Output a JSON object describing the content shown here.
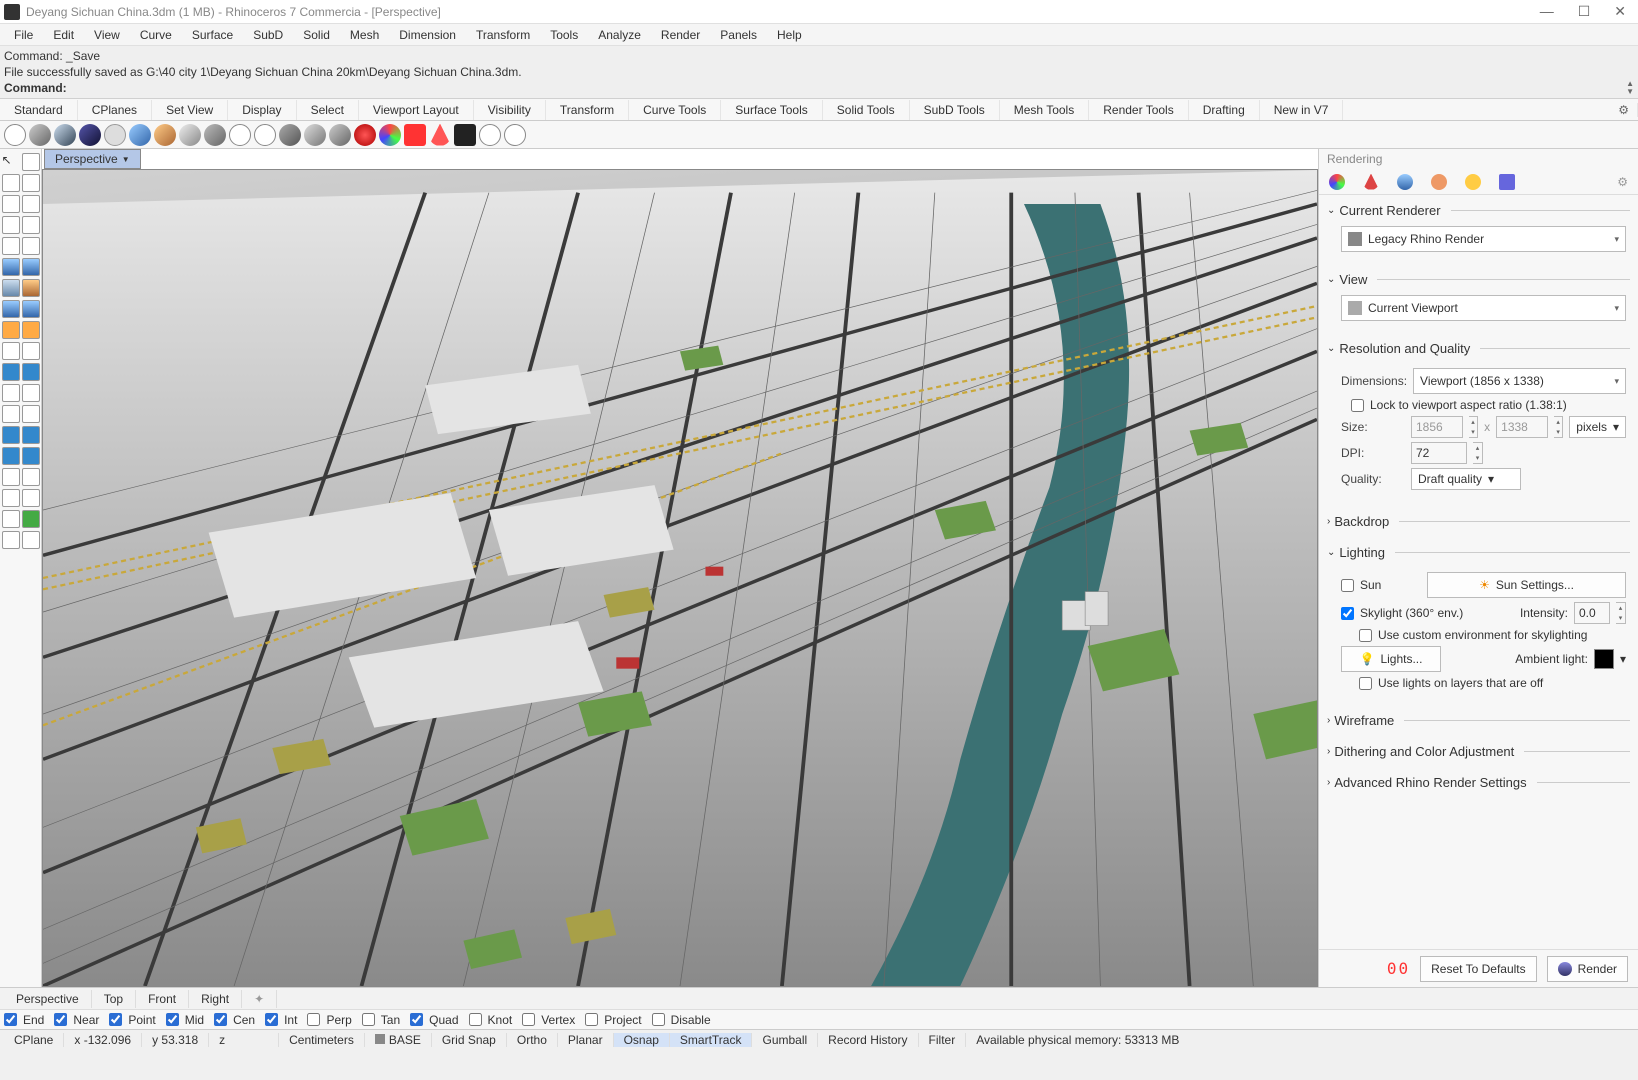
{
  "title": "Deyang Sichuan China.3dm (1 MB) - Rhinoceros 7 Commercia - [Perspective]",
  "menubar": [
    "File",
    "Edit",
    "View",
    "Curve",
    "Surface",
    "SubD",
    "Solid",
    "Mesh",
    "Dimension",
    "Transform",
    "Tools",
    "Analyze",
    "Render",
    "Panels",
    "Help"
  ],
  "cmd": {
    "line1": "Command: _Save",
    "line2": "File successfully saved as G:\\40 city 1\\Deyang Sichuan China 20km\\Deyang Sichuan China.3dm.",
    "prompt": "Command:"
  },
  "tabstrip": [
    "Standard",
    "CPlanes",
    "Set View",
    "Display",
    "Select",
    "Viewport Layout",
    "Visibility",
    "Transform",
    "Curve Tools",
    "Surface Tools",
    "Solid Tools",
    "SubD Tools",
    "Mesh Tools",
    "Render Tools",
    "Drafting",
    "New in V7"
  ],
  "viewport_tab": "Perspective",
  "panel": {
    "title": "Rendering",
    "sections": {
      "renderer": {
        "title": "Current Renderer",
        "value": "Legacy Rhino Render"
      },
      "view": {
        "title": "View",
        "value": "Current Viewport"
      },
      "resq": {
        "title": "Resolution and Quality",
        "dimensions_label": "Dimensions:",
        "dimensions_value": "Viewport (1856 x 1338)",
        "lock_label": "Lock to viewport aspect ratio (1.38:1)",
        "size_label": "Size:",
        "width": "1856",
        "height": "1338",
        "units": "pixels",
        "dpi_label": "DPI:",
        "dpi": "72",
        "quality_label": "Quality:",
        "quality_value": "Draft quality"
      },
      "backdrop": {
        "title": "Backdrop"
      },
      "lighting": {
        "title": "Lighting",
        "sun_label": "Sun",
        "sun_settings": "Sun Settings...",
        "skylight_label": "Skylight (360° env.)",
        "intensity_label": "Intensity:",
        "intensity_value": "0.0",
        "custom_env_label": "Use custom environment for skylighting",
        "lights_btn": "Lights...",
        "ambient_label": "Ambient light:",
        "use_lights_layers": "Use lights on layers that are off"
      },
      "wireframe": {
        "title": "Wireframe"
      },
      "dithering": {
        "title": "Dithering and Color Adjustment"
      },
      "advanced": {
        "title": "Advanced Rhino Render Settings"
      }
    },
    "footer": {
      "reset": "Reset To Defaults",
      "render": "Render"
    }
  },
  "viewtabs": [
    "Perspective",
    "Top",
    "Front",
    "Right"
  ],
  "osnap": {
    "items": [
      {
        "label": "End",
        "checked": true
      },
      {
        "label": "Near",
        "checked": true
      },
      {
        "label": "Point",
        "checked": true
      },
      {
        "label": "Mid",
        "checked": true
      },
      {
        "label": "Cen",
        "checked": true
      },
      {
        "label": "Int",
        "checked": true
      },
      {
        "label": "Perp",
        "checked": false
      },
      {
        "label": "Tan",
        "checked": false
      },
      {
        "label": "Quad",
        "checked": true
      },
      {
        "label": "Knot",
        "checked": false
      },
      {
        "label": "Vertex",
        "checked": false
      },
      {
        "label": "Project",
        "checked": false
      },
      {
        "label": "Disable",
        "checked": false
      }
    ]
  },
  "status": {
    "cplane": "CPlane",
    "x": "x -132.096",
    "y": "y 53.318",
    "z": "z",
    "units": "Centimeters",
    "layer": "BASE",
    "toggles": [
      "Grid Snap",
      "Ortho",
      "Planar",
      "Osnap",
      "SmartTrack",
      "Gumball",
      "Record History",
      "Filter"
    ],
    "mem": "Available physical memory: 53313 MB"
  }
}
